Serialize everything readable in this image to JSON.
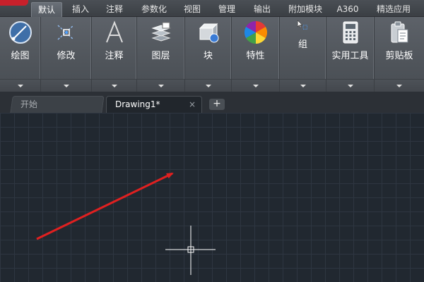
{
  "menu": {
    "tabs": [
      {
        "label": "默认",
        "active": true
      },
      {
        "label": "插入"
      },
      {
        "label": "注释"
      },
      {
        "label": "参数化"
      },
      {
        "label": "视图"
      },
      {
        "label": "管理"
      },
      {
        "label": "输出"
      },
      {
        "label": "附加模块"
      },
      {
        "label": "A360"
      },
      {
        "label": "精选应用"
      }
    ]
  },
  "ribbon": {
    "panels": [
      {
        "label": "绘图",
        "icon": "draw-circle-icon"
      },
      {
        "label": "修改",
        "icon": "modify-move-icon"
      },
      {
        "label": "注释",
        "icon": "annotation-text-icon"
      },
      {
        "label": "图层",
        "icon": "layers-icon"
      },
      {
        "label": "块",
        "icon": "block-insert-icon"
      },
      {
        "label": "特性",
        "icon": "properties-color-wheel-icon"
      },
      {
        "label": "组",
        "icon": "group-icon"
      },
      {
        "label": "实用工具",
        "icon": "calculator-icon"
      },
      {
        "label": "剪贴板",
        "icon": "clipboard-icon"
      }
    ]
  },
  "doc_tabs": {
    "start_label": "开始",
    "drawing_label": "Drawing1*",
    "close_glyph": "×",
    "new_tab_glyph": "+"
  },
  "colors": {
    "canvas_bg": "#212830",
    "grid": "#2e3641",
    "annotation_arrow": "#e02020",
    "crosshair": "#ffffff",
    "brand_red": "#c8202b"
  }
}
